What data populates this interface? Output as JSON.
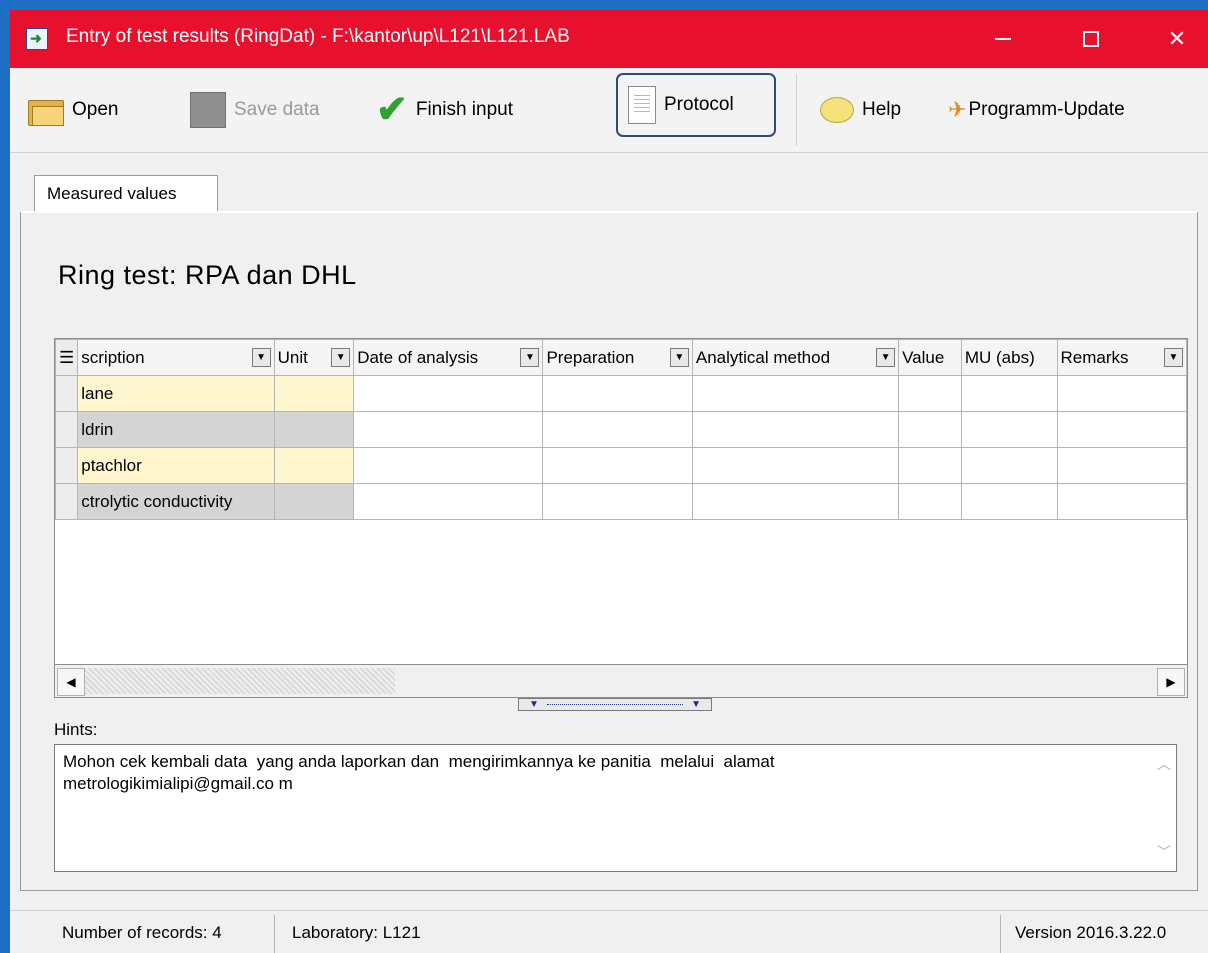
{
  "window": {
    "title": "Entry of test results (RingDat) - F:\\kantor\\up\\L121\\L121.LAB",
    "controls": {
      "minimize": "minimize",
      "maximize": "maximize",
      "close": "✕"
    }
  },
  "toolbar": {
    "open_label": "Open",
    "save_label": "Save data",
    "finish_label": "Finish input",
    "protocol_label": "Protocol",
    "help_label": "Help",
    "update_label": "Programm-Update"
  },
  "tabs": [
    {
      "label": "Measured values"
    }
  ],
  "main": {
    "ring_title": "Ring test: RPA dan DHL"
  },
  "grid": {
    "columns": [
      "scription",
      "Unit",
      "Date of analysis",
      "Preparation",
      "Analytical method",
      "Value",
      "MU (abs)",
      "Remarks"
    ],
    "rows": [
      {
        "description": "lane",
        "unit": "",
        "date": "",
        "preparation": "",
        "method": "",
        "value": "",
        "mu": "",
        "remarks": ""
      },
      {
        "description": "ldrin",
        "unit": "",
        "date": "",
        "preparation": "",
        "method": "",
        "value": "",
        "mu": "",
        "remarks": ""
      },
      {
        "description": "ptachlor",
        "unit": "",
        "date": "",
        "preparation": "",
        "method": "",
        "value": "",
        "mu": "",
        "remarks": ""
      },
      {
        "description": "ctrolytic conductivity",
        "unit": "",
        "date": "",
        "preparation": "",
        "method": "",
        "value": "",
        "mu": "",
        "remarks": ""
      }
    ]
  },
  "hints": {
    "label": "Hints:",
    "line1": "Mohon cek kembali data  yang anda laporkan dan  mengirimkannya ke panitia  melalui  alamat",
    "line2": "metrologikimialipi@gmail.co m"
  },
  "status": {
    "records": "Number of records: 4",
    "laboratory": "Laboratory: L121",
    "version": "Version 2016.3.22.0"
  },
  "colors": {
    "titlebar": "#e8112d",
    "protocol_highlight": "#2f4b70",
    "editable_cell": "#fdf6cf",
    "readonly_cell": "#d4d4d4"
  }
}
